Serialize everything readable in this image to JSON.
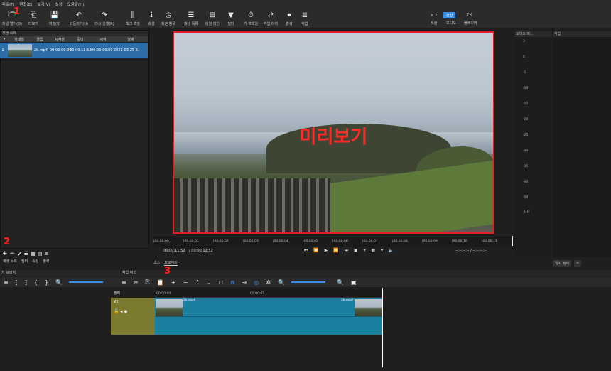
{
  "menu": [
    "파일(F)",
    "편집(E)",
    "보기(V)",
    "설정",
    "도움말(H)"
  ],
  "toolbar": [
    {
      "icon": "folder-open-icon",
      "label": "파일 열기(O)"
    },
    {
      "icon": "open-other-icon",
      "label": "더보기"
    },
    {
      "icon": "save-icon",
      "label": "저장(S)"
    },
    {
      "icon": "undo-icon",
      "label": "되돌리기(U)"
    },
    {
      "icon": "redo-icon",
      "label": "다시 실행(R)"
    },
    {
      "icon": "peak-meter-icon",
      "label": "피크 측정"
    },
    {
      "icon": "properties-icon",
      "label": "속성"
    },
    {
      "icon": "recent-icon",
      "label": "최근 항목"
    },
    {
      "icon": "playlist-icon",
      "label": "재생 목록"
    },
    {
      "icon": "timeline-icon",
      "label": "타임 라인"
    },
    {
      "icon": "filter-icon",
      "label": "필터"
    },
    {
      "icon": "keyframe-icon",
      "label": "키 프레임"
    },
    {
      "icon": "history-icon",
      "label": "작업 이력"
    },
    {
      "icon": "export-icon",
      "label": "출력"
    },
    {
      "icon": "jobs-icon",
      "label": "작업"
    }
  ],
  "workspaces_top": [
    "로그",
    "편집",
    "FX"
  ],
  "workspaces_bottom": [
    "색상",
    "오디오",
    "플레이어"
  ],
  "playlist": {
    "title": "재생 목록",
    "columns": [
      "▾",
      "섬네일",
      "클립",
      "시작점",
      "길이",
      "시작",
      "날짜"
    ],
    "rows": [
      {
        "index": "1",
        "clip": "2k.mp4",
        "in": "00:00:00:00",
        "duration": "00:00:11:52",
        "start": "00:00:00:00",
        "date": "2021-03-25 2..."
      }
    ]
  },
  "preview_label": "미리보기",
  "markers": {
    "one": "1",
    "two": "2",
    "three": "3"
  },
  "ruler_ticks": [
    "|00:00:00",
    "|00:00:01",
    "|00:00:02",
    "|00:00:03",
    "|00:00:04",
    "|00:00:05",
    "|00:00:06",
    "|00:00:07",
    "|00:00:08",
    "|00:00:09",
    "|00:00:10",
    "|00:00:11"
  ],
  "timecode": {
    "current": "00:00:11:52",
    "total": "/ 00:00:11:52",
    "in_out": "--:--:--:-- /  --:--:--:--"
  },
  "tabs_left": [
    "재생 목록",
    "필터",
    "속성",
    "출력"
  ],
  "tabs_preview": [
    "소스",
    "프로젝트"
  ],
  "meter_ticks": [
    "3",
    "0",
    "-5",
    "-10",
    "-15",
    "-20",
    "-25",
    "-30",
    "-35",
    "-40",
    "-50"
  ],
  "meter_lr": "L R",
  "meter_title": "오디오 피...",
  "props_title": "작업",
  "props_btn": "일시 정지",
  "bottom_panels": {
    "keyframes": "키 프레임",
    "history": "작업 이력"
  },
  "timeline": {
    "header": "출력",
    "track": "V1",
    "ticks": [
      "00:00:00",
      "00:00:05"
    ],
    "clip_labels": [
      "2k.mp4",
      "2k.mp4"
    ]
  },
  "colors": {
    "accent": "#3a8ee6",
    "marker": "#ff2020",
    "track": "#1b7fa0",
    "trackhead": "#7b7a2e"
  }
}
